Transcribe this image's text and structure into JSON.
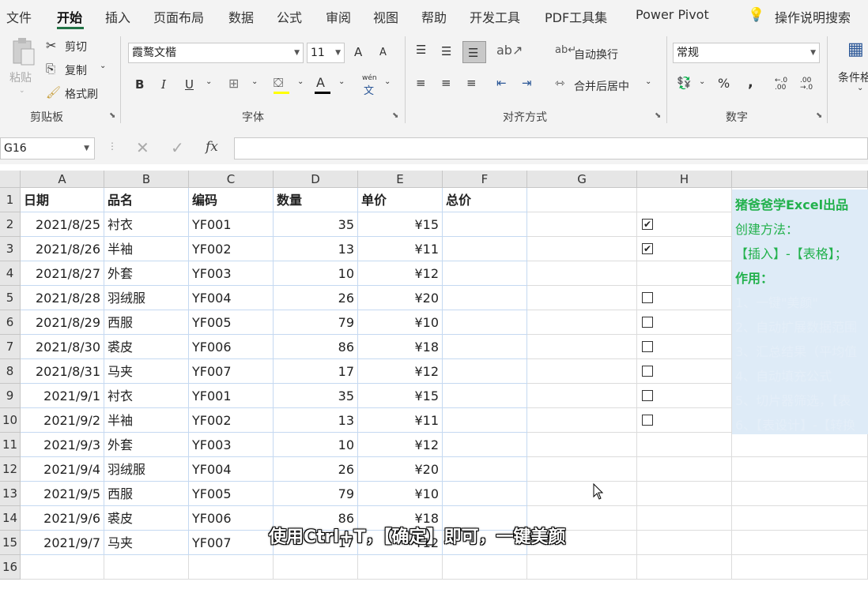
{
  "tabs": [
    "文件",
    "开始",
    "插入",
    "页面布局",
    "数据",
    "公式",
    "审阅",
    "视图",
    "帮助",
    "开发工具",
    "PDF工具集",
    "Power Pivot"
  ],
  "tell_me": "操作说明搜索",
  "clipboard": {
    "paste": "粘贴",
    "cut": "剪切",
    "copy": "复制",
    "format_painter": "格式刷",
    "label": "剪贴板"
  },
  "font": {
    "name": "霞鹜文楷",
    "size": "11",
    "grow": "A",
    "shrink": "A",
    "bold": "B",
    "italic": "I",
    "underline": "U",
    "color_letter": "A",
    "phonetic": "wén",
    "label": "字体"
  },
  "alignment": {
    "wrap": "自动换行",
    "merge": "合并后居中",
    "label": "对齐方式"
  },
  "number": {
    "format": "常规",
    "percent": "%",
    "comma": ",",
    "inc_dec": "←.0 .00",
    "dec_dec": ".00 →.0",
    "label": "数字"
  },
  "styles": {
    "conditional": "条件格"
  },
  "namebox": "G16",
  "fx": "fx",
  "columns": [
    "A",
    "B",
    "C",
    "D",
    "E",
    "F",
    "G",
    "H"
  ],
  "rows": [
    "1",
    "2",
    "3",
    "4",
    "5",
    "6",
    "7",
    "8",
    "9",
    "10",
    "11",
    "12",
    "13",
    "14",
    "15",
    "16"
  ],
  "table": {
    "headers": [
      "日期",
      "品名",
      "编码",
      "数量",
      "单价",
      "总价"
    ],
    "data": [
      [
        "2021/8/25",
        "衬衣",
        "YF001",
        "35",
        "¥15"
      ],
      [
        "2021/8/26",
        "半袖",
        "YF002",
        "13",
        "¥11"
      ],
      [
        "2021/8/27",
        "外套",
        "YF003",
        "10",
        "¥12"
      ],
      [
        "2021/8/28",
        "羽绒服",
        "YF004",
        "26",
        "¥20"
      ],
      [
        "2021/8/29",
        "西服",
        "YF005",
        "79",
        "¥10"
      ],
      [
        "2021/8/30",
        "裘皮",
        "YF006",
        "86",
        "¥18"
      ],
      [
        "2021/8/31",
        "马夹",
        "YF007",
        "17",
        "¥12"
      ],
      [
        "2021/9/1",
        "衬衣",
        "YF001",
        "35",
        "¥15"
      ],
      [
        "2021/9/2",
        "半袖",
        "YF002",
        "13",
        "¥11"
      ],
      [
        "2021/9/3",
        "外套",
        "YF003",
        "10",
        "¥12"
      ],
      [
        "2021/9/4",
        "羽绒服",
        "YF004",
        "26",
        "¥20"
      ],
      [
        "2021/9/5",
        "西服",
        "YF005",
        "79",
        "¥10"
      ],
      [
        "2021/9/6",
        "裘皮",
        "YF006",
        "86",
        "¥18"
      ],
      [
        "2021/9/7",
        "马夹",
        "YF007",
        "17",
        "¥12"
      ]
    ]
  },
  "checkboxes": [
    true,
    true,
    null,
    false,
    false,
    false,
    false,
    false,
    false
  ],
  "side": {
    "title": "猪爸爸学Excel出品",
    "method": "创建方法：",
    "method_detail": "【插入】-【表格】；",
    "usage": "作用：",
    "items": [
      "1、一键\"美颜\"",
      "2、自动扩展数据范围",
      "3、汇总结果（平均值",
      "4、自动填充公式",
      "5、切片器筛选，【表",
      "6、【表设计】-【转换"
    ]
  },
  "caption": "使用Ctrl+T，【确定】即可，一键美颜",
  "colors": {
    "accent": "#217346",
    "table_line": "#c5d9f1",
    "side_green": "#22b14c"
  }
}
